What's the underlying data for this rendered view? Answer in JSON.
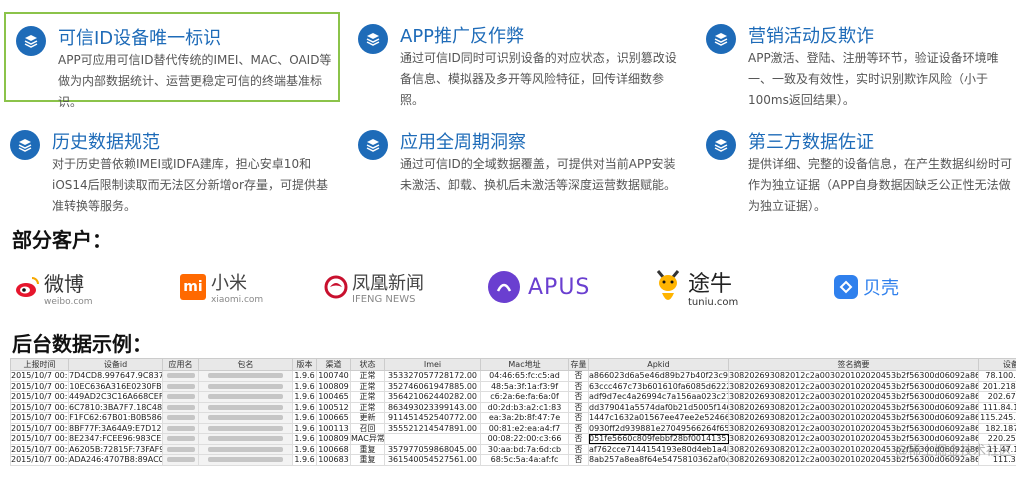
{
  "features": [
    {
      "title": "可信ID设备唯一标识",
      "desc": "APP可应用可信ID替代传统的IMEI、MAC、OAID等做为内部数据统计、运营更稳定可信的终端基准标识。"
    },
    {
      "title": "APP推广反作弊",
      "desc": "通过可信ID同时可识别设备的对应状态，识别篡改设备信息、模拟器及多开等风险特征，回传详细数参照。"
    },
    {
      "title": "营销活动反欺诈",
      "desc": "APP激活、登陆、注册等环节，验证设备环境唯一、一致及有效性，实时识别欺诈风险（小于100ms返回结果）。"
    },
    {
      "title": "历史数据规范",
      "desc": "对于历史普依赖IMEI或IDFA建库，担心安卓10和iOS14后限制读取而无法区分新增or存量，可提供基准转换等服务。"
    },
    {
      "title": "应用全周期洞察",
      "desc": "通过可信ID的全域数据覆盖，可提供对当前APP安装未激活、卸载、换机后未激活等深度运营数据赋能。"
    },
    {
      "title": "第三方数据佐证",
      "desc": "提供详细、完整的设备信息，在产生数据纠纷时可作为独立证据（APP自身数据因缺乏公正性无法做为独立证据）。"
    }
  ],
  "sections": {
    "customers_title": "部分客户：",
    "backend_title": "后台数据示例："
  },
  "logos": [
    {
      "name": "微博",
      "sub": "weibo.com"
    },
    {
      "name": "小米",
      "sub": "xiaomi.com"
    },
    {
      "name": "凤凰新闻",
      "sub": "IFENG NEWS"
    },
    {
      "name": "APUS",
      "sub": ""
    },
    {
      "name": "途牛",
      "sub": "tuniu.com"
    },
    {
      "name": "贝壳",
      "sub": ""
    }
  ],
  "table": {
    "headers": [
      "上报时间",
      "设备id",
      "应用名",
      "包名",
      "版本",
      "渠道",
      "状态",
      "Imei",
      "Mac地址",
      "存量",
      "Apkid",
      "签名摘要",
      "设备IP"
    ],
    "rows": [
      [
        "2015/10/7 00:0",
        "7D4CD8.997647.9C837F",
        "",
        "",
        "1.9.6",
        "100740",
        "正常",
        "353327057728172.00",
        "04:46:65:fc:c5:ad",
        "否",
        "a866023d6a5e46d89b27b40f23c96425",
        "308202693082012c2a003020102020453b2f56300d06092a864886f70d010010",
        "78.100.179.13"
      ],
      [
        "2015/10/7 00:0",
        "10EC636A316E0230FB",
        "",
        "",
        "1.9.6",
        "100809",
        "正常",
        "352746061947885.00",
        "48:5a:3f:1a:f3:9f",
        "否",
        "63ccc467c73b601610fa6085d62229de",
        "308202693082012c2a003020102020453b2f56300d06092a864886f70d010010",
        "201.218.28.242"
      ],
      [
        "2015/10/7 00:0",
        "449AD2C3C16A668CEF",
        "",
        "",
        "1.9.6",
        "100465",
        "正常",
        "356421062440282.00",
        "c6:2a:6e:fa:6a:0f",
        "否",
        "adf9d7ec4a26994c7a156aa023c27820",
        "308202693082012c2a003020102020453b2f56300d06092a864886f70d010010",
        "202.67.37.43"
      ],
      [
        "2015/10/7 00:0",
        "6C7810:3BA7F7.18C481",
        "",
        "",
        "1.9.6",
        "100512",
        "正常",
        "863493023399143.00",
        "d0:2d:b3:a2:c1:83",
        "否",
        "dd379041a5574daf0b21d5005f1465b12",
        "308202693082012c2a003020102020453b2f56300d06092a864886f70d010010",
        "111.84.155.115"
      ],
      [
        "2015/10/7 00:0",
        "F1FC62:67B01:B0B586",
        "",
        "",
        "1.9.6",
        "100665",
        "更新",
        "911451452540772.00",
        "ea:3a:2b:8f:47:7e",
        "否",
        "1447c1632a01567ee47ee2e52466d1ae",
        "308202693082012c2a003020102020453b2f56300d06092a864886f70d010010",
        "115.245.203.122"
      ],
      [
        "2015/10/7 00:0",
        "8BF77F:3A64A9:E7D121",
        "",
        "",
        "1.9.6",
        "100113",
        "召回",
        "355521214547891.00",
        "00:81:e2:ea:a4:f7",
        "否",
        "0930ff2d939881e27049566264f65a41",
        "308202693082012c2a003020102020453b2f56300d06092a864886f70d010010",
        "182.187.66.86"
      ],
      [
        "2015/10/7 00:0",
        "8E2347:FCEE96:983CE5",
        "",
        "",
        "1.9.6",
        "100809",
        "MAC异常",
        "",
        "00:08:22:00:c3:66",
        "否",
        "051fe5660c809febbf28bf0014135148",
        "308202693082012c2a003020102020453b2f56300d06092a864886f70d010010",
        "220.255.1.50"
      ],
      [
        "2015/10/7 00:0",
        "A6205B:72815F:73FAF9",
        "",
        "",
        "1.9.6",
        "100668",
        "重复",
        "357977059868045.00",
        "30:aa:bd:7a:6d:cb",
        "否",
        "af762cce7144154193e80d4eb1a4bc31",
        "308202693082012c2a003020102020453b2f56300d06092a864886f70d010010",
        "11.47.107.90"
      ],
      [
        "2015/10/7 00:0",
        "ADA246:4707B8:89AC07",
        "",
        "",
        "1.9.6",
        "100683",
        "重复",
        "361540054527561.00",
        "68:5c:5a:4a:af:fc",
        "否",
        "8ab257a8ea8f64e5475810362af0c7e",
        "308202693082012c2a003020102020453b2f56300d06092a864886f70d010010",
        "111.3.64.4"
      ]
    ]
  },
  "watermark": "@稀土掘金技术社区",
  "colors": {
    "brand_blue": "#1e6bb8",
    "highlight_green": "#8bc34a"
  }
}
